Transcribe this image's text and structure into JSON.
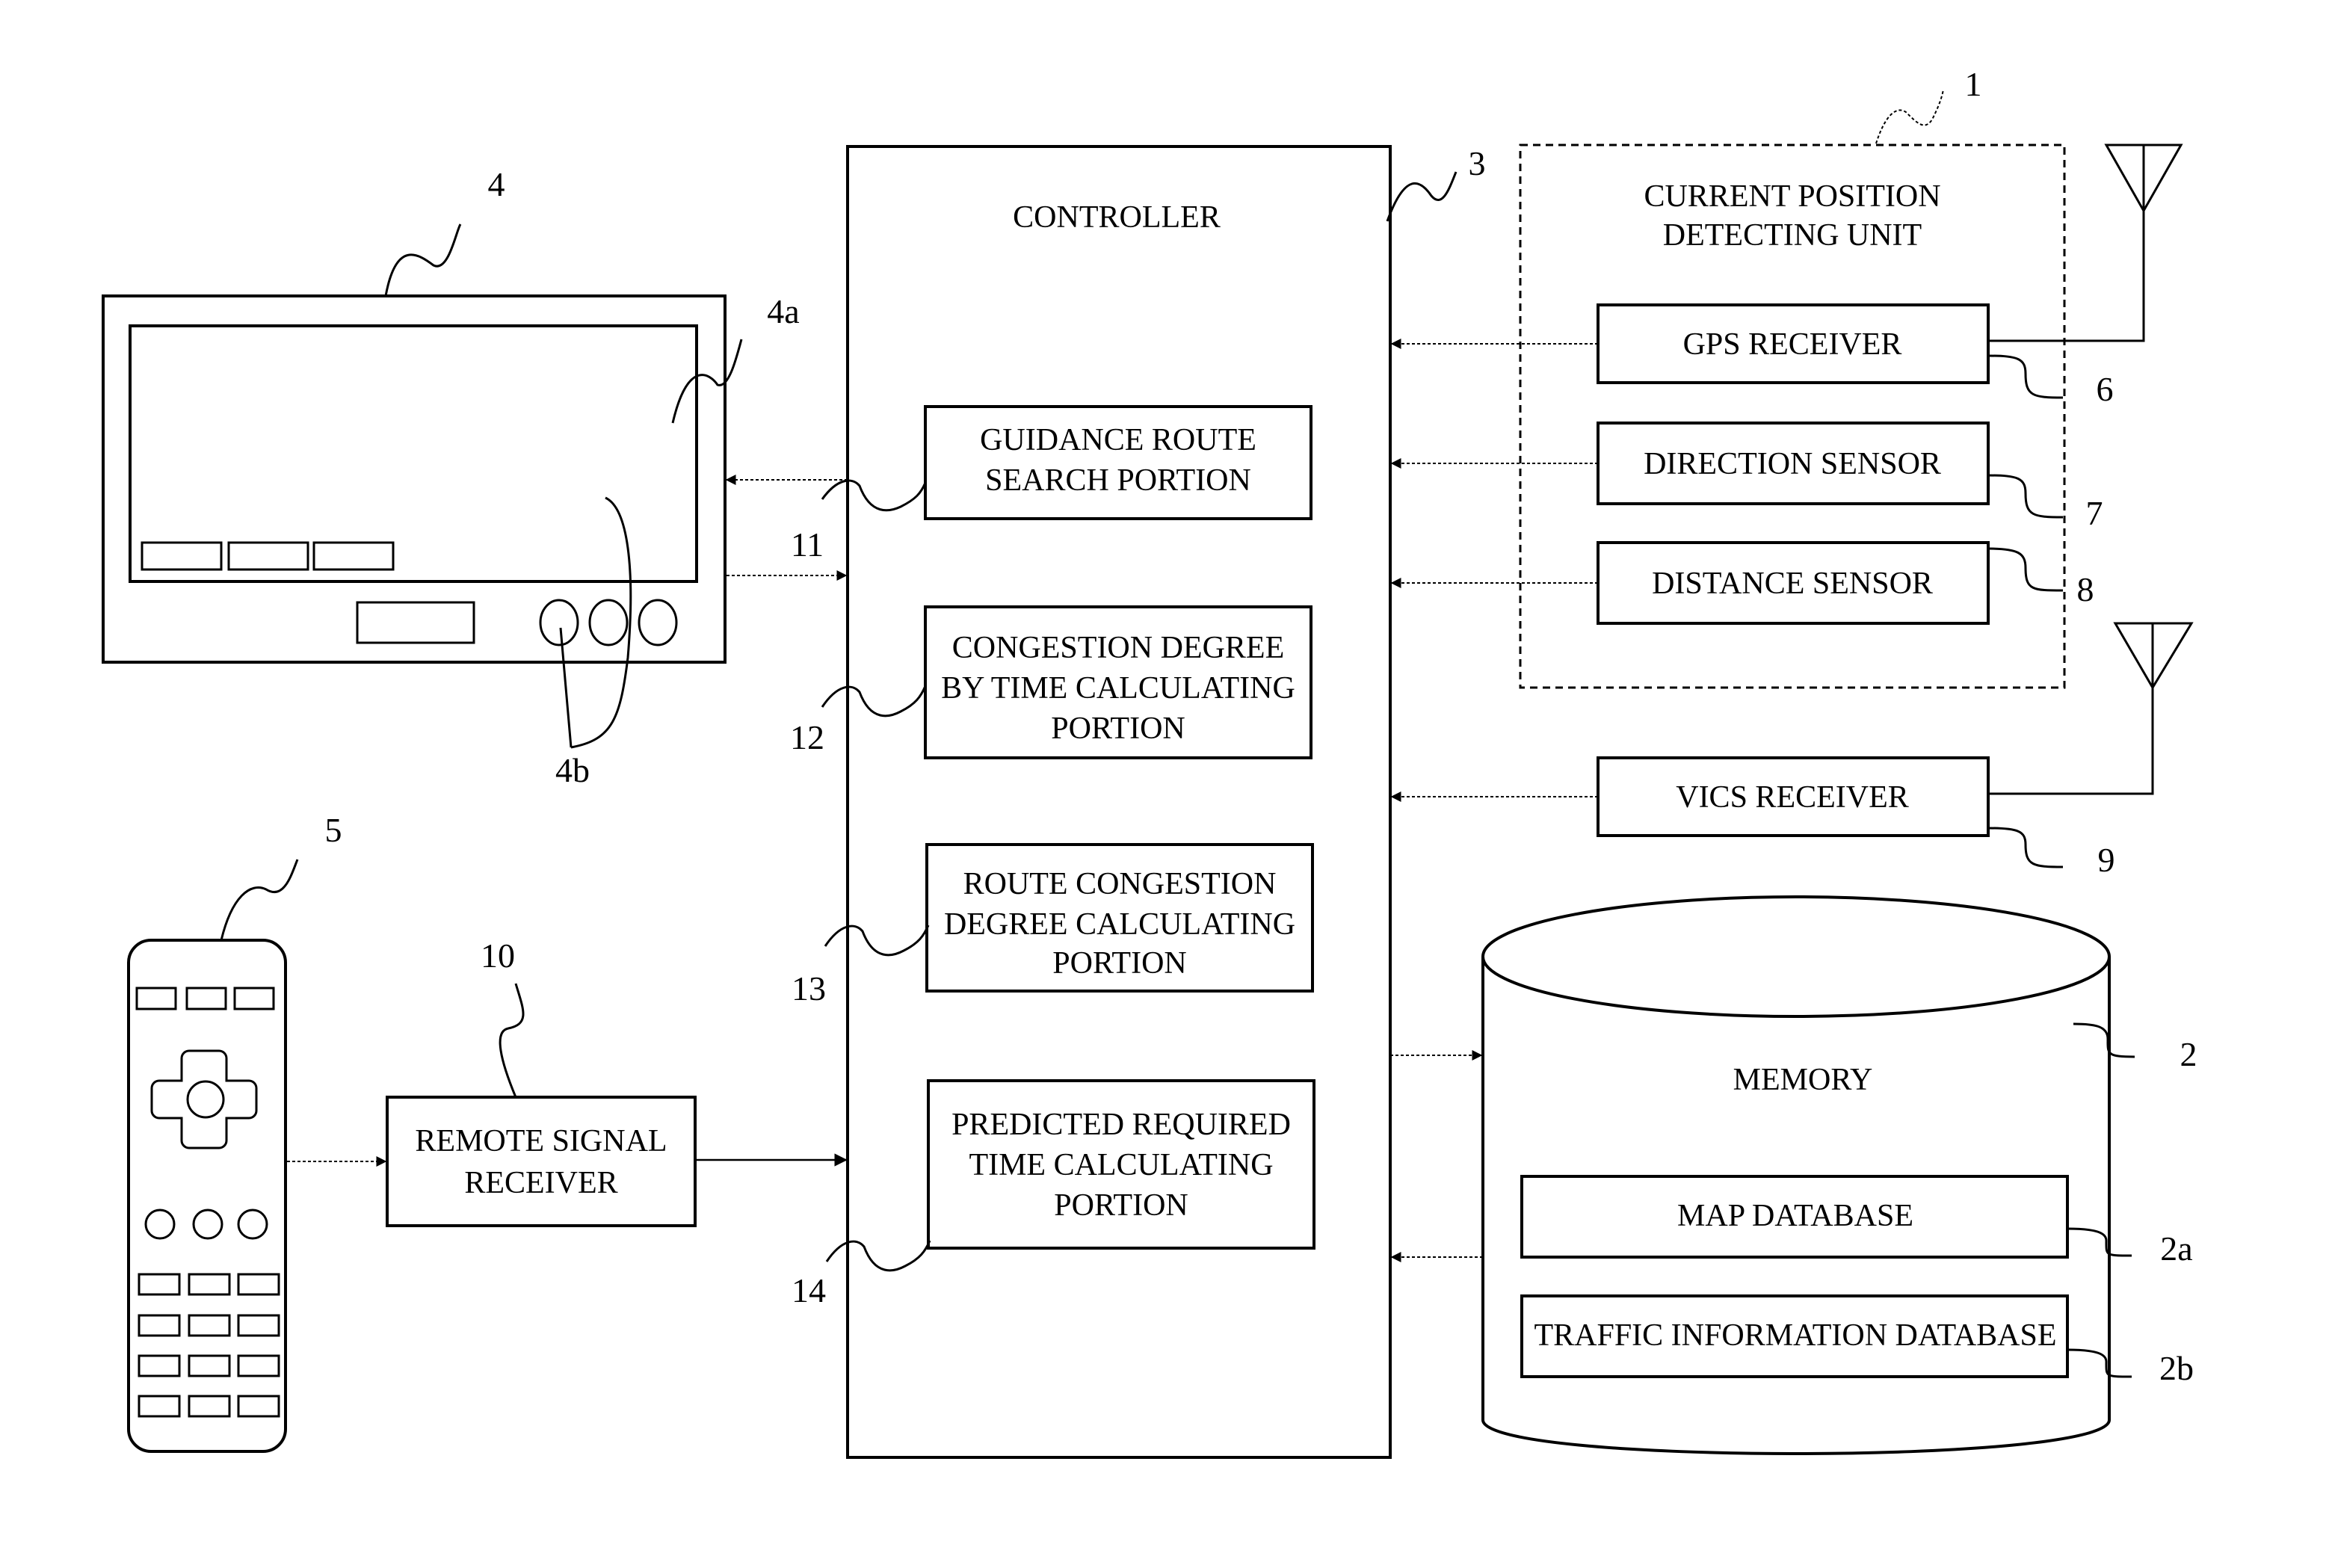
{
  "figure": {
    "controller": {
      "title": "CONTROLLER",
      "ref": "3",
      "portions": [
        {
          "ref": "11",
          "lines": [
            "GUIDANCE ROUTE",
            "SEARCH PORTION"
          ]
        },
        {
          "ref": "12",
          "lines": [
            "CONGESTION DEGREE",
            "BY TIME CALCULATING",
            "PORTION"
          ]
        },
        {
          "ref": "13",
          "lines": [
            "ROUTE CONGESTION",
            "DEGREE CALCULATING",
            "PORTION"
          ]
        },
        {
          "ref": "14",
          "lines": [
            "PREDICTED REQUIRED",
            "TIME CALCULATING",
            "PORTION"
          ]
        }
      ]
    },
    "position_unit": {
      "ref": "1",
      "title_lines": [
        "CURRENT POSITION",
        "DETECTING UNIT"
      ],
      "components": [
        {
          "ref": "6",
          "label": "GPS RECEIVER"
        },
        {
          "ref": "7",
          "label": "DIRECTION SENSOR"
        },
        {
          "ref": "8",
          "label": "DISTANCE SENSOR"
        }
      ]
    },
    "vics": {
      "ref": "9",
      "label": "VICS RECEIVER"
    },
    "memory": {
      "ref": "2",
      "title": "MEMORY",
      "databases": [
        {
          "ref": "2a",
          "label": "MAP DATABASE"
        },
        {
          "ref": "2b",
          "label": "TRAFFIC INFORMATION DATABASE"
        }
      ]
    },
    "display": {
      "ref": "4",
      "screen_ref": "4a",
      "buttons_ref": "4b"
    },
    "remote": {
      "ref": "5"
    },
    "remote_receiver": {
      "ref": "10",
      "lines": [
        "REMOTE SIGNAL",
        "RECEIVER"
      ]
    }
  }
}
